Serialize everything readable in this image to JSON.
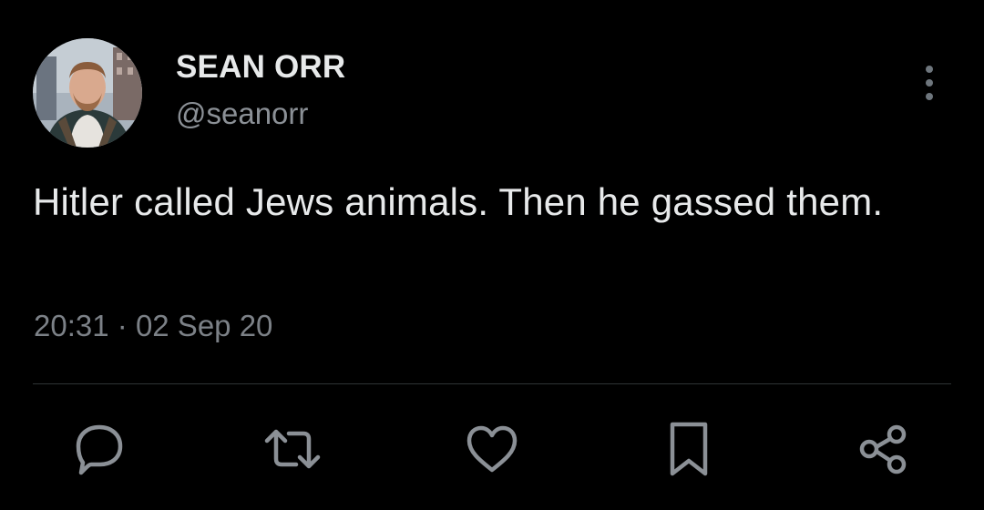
{
  "author": {
    "display_name": "SEAN ORR",
    "handle": "@seanorr",
    "avatar_icon": "profile-photo"
  },
  "tweet": {
    "text": "Hitler called Jews animals. Then he gassed them.",
    "time": "20:31",
    "separator": "·",
    "date": "02 Sep 20"
  },
  "actions": {
    "reply_icon": "speech-bubble-icon",
    "retweet_icon": "retweet-arrows-icon",
    "like_icon": "heart-outline-icon",
    "bookmark_icon": "bookmark-outline-icon",
    "share_icon": "share-nodes-icon",
    "more_icon": "vertical-ellipsis-icon"
  },
  "colors": {
    "background": "#000000",
    "primary_text": "#e7e9ea",
    "secondary_text": "#8b9096",
    "divider": "#2f3336",
    "icon": "#8b9096"
  }
}
